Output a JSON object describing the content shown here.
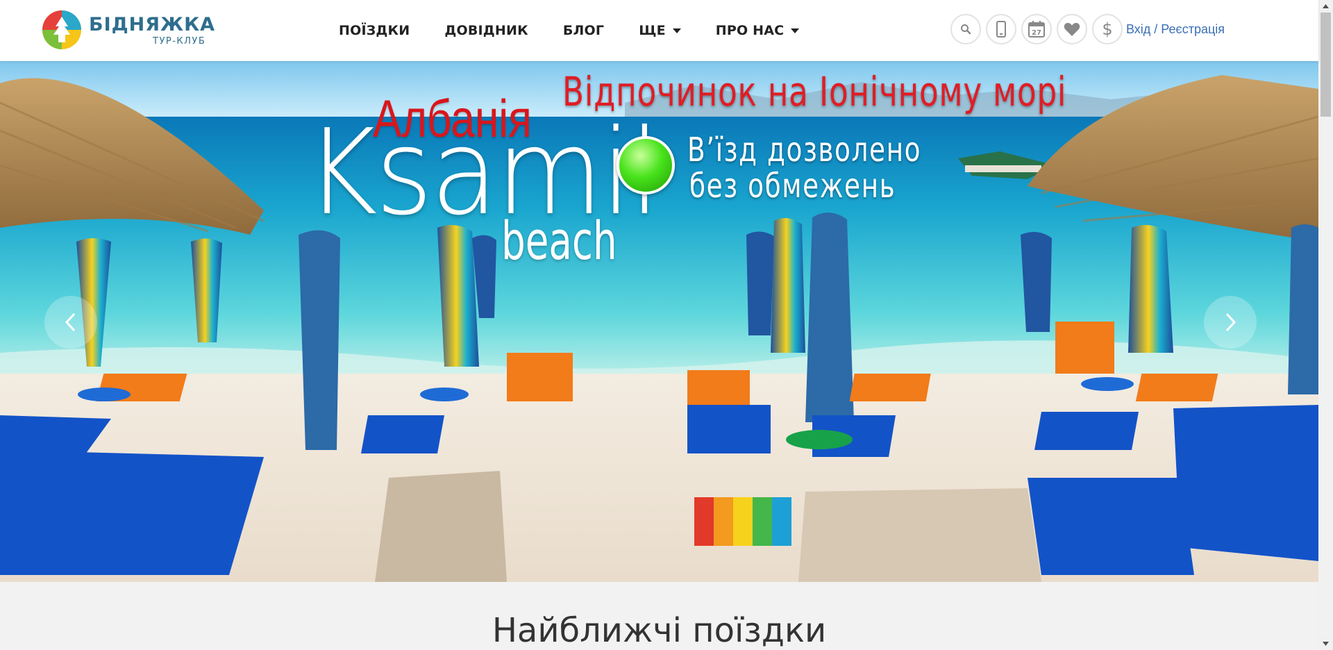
{
  "brand": {
    "name": "БІДНЯЖКА",
    "tagline": "ТУР-КЛУБ"
  },
  "nav": [
    {
      "label": "ПОЇЗДКИ"
    },
    {
      "label": "ДОВІДНИК"
    },
    {
      "label": "БЛОГ"
    },
    {
      "label": "ЩЕ",
      "dropdown": true
    },
    {
      "label": "ПРО НАС",
      "dropdown": true
    }
  ],
  "tools": {
    "icons": [
      "search-icon",
      "phone-icon",
      "calendar-icon",
      "heart-icon",
      "dollar-icon"
    ],
    "calendar_day": "27",
    "login_label": "Вхід / Реєстрація"
  },
  "hero": {
    "headline": "Відпочинок на Іонічному морі",
    "country": "Албанія",
    "place": "Ksamil",
    "place_sub": "beach",
    "entry_line1": "В’їзд дозволено",
    "entry_line2": "без обмежень"
  },
  "section": {
    "title": "Найближчі поїздки"
  },
  "colors": {
    "brand_text": "#2e6e8e",
    "link": "#3b6fb6",
    "headline_red": "#e01d24",
    "status_green": "#49e31c"
  }
}
